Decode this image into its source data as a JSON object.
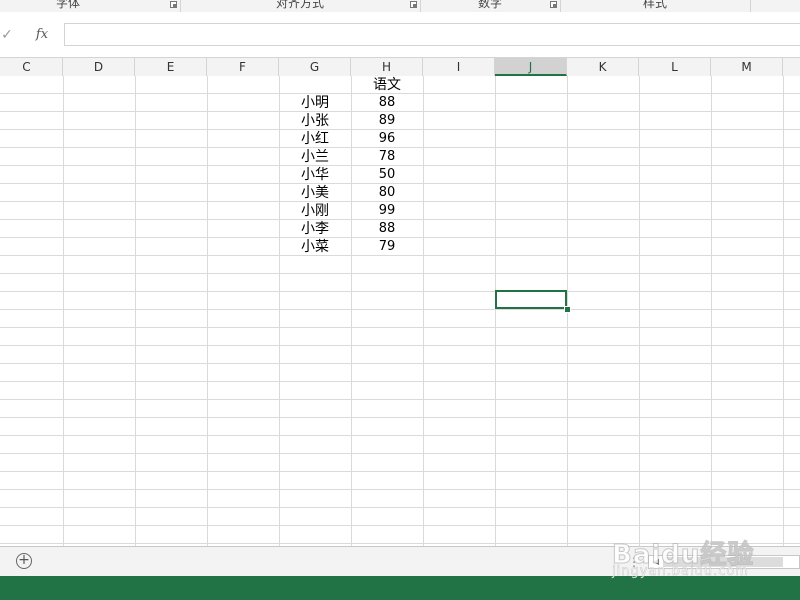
{
  "ribbon": {
    "groups": [
      {
        "label": "字体"
      },
      {
        "label": "对齐方式"
      },
      {
        "label": "数字"
      },
      {
        "label": "样式"
      }
    ]
  },
  "formula_bar": {
    "check_symbol": "✓",
    "fx_label": "fx",
    "content": ""
  },
  "columns": [
    "C",
    "D",
    "E",
    "F",
    "G",
    "H",
    "I",
    "J",
    "K",
    "L",
    "M"
  ],
  "selected_column": "J",
  "table": {
    "header": "语文",
    "rows": [
      {
        "name": "小明",
        "score": "88"
      },
      {
        "name": "小张",
        "score": "89"
      },
      {
        "name": "小红",
        "score": "96"
      },
      {
        "name": "小兰",
        "score": "78"
      },
      {
        "name": "小华",
        "score": "50"
      },
      {
        "name": "小美",
        "score": "80"
      },
      {
        "name": "小刚",
        "score": "99"
      },
      {
        "name": "小李",
        "score": "88"
      },
      {
        "name": "小菜",
        "score": "79"
      }
    ]
  },
  "sheet_bar": {
    "add_symbol": "+",
    "dots": "⋮",
    "scroll_left_symbol": "◀"
  },
  "colors": {
    "accent": "#217346",
    "gridline": "#dadada",
    "header_bg": "#f3f3f3"
  },
  "watermark": {
    "brand": "Baidu经验",
    "url": "jingyan.baidu.com"
  }
}
